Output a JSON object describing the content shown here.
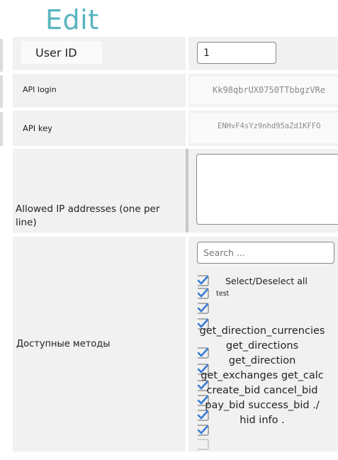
{
  "page": {
    "title": "Edit"
  },
  "form": {
    "user_id": {
      "label": "User ID",
      "value": "1"
    },
    "api_login": {
      "label": "API login",
      "value": "Kk98qbrUX0750TTbbgzVRe"
    },
    "api_key": {
      "label": "API key",
      "value": "ENHvF4sYz9nhd95aZd1KFFO"
    },
    "allowed_ip": {
      "label_line1": "Allowed IP addresses (one per",
      "label_line2": "line)",
      "value": ""
    },
    "methods": {
      "label": "Доступные методы",
      "search_placeholder": "Search ...",
      "select_all": "Select/Deselect all",
      "items": [
        "test",
        "get_direction_currencies",
        "get_directions",
        "get_direction",
        "get_exchanges get_calc",
        "create_bid cancel_bid",
        "pay_bid success_bid ./",
        "hid info ."
      ]
    }
  },
  "colors": {
    "title": "#5ab5c0",
    "checkbox_accent": "#3a7bd5",
    "row_bg": "#f1f1f1"
  }
}
